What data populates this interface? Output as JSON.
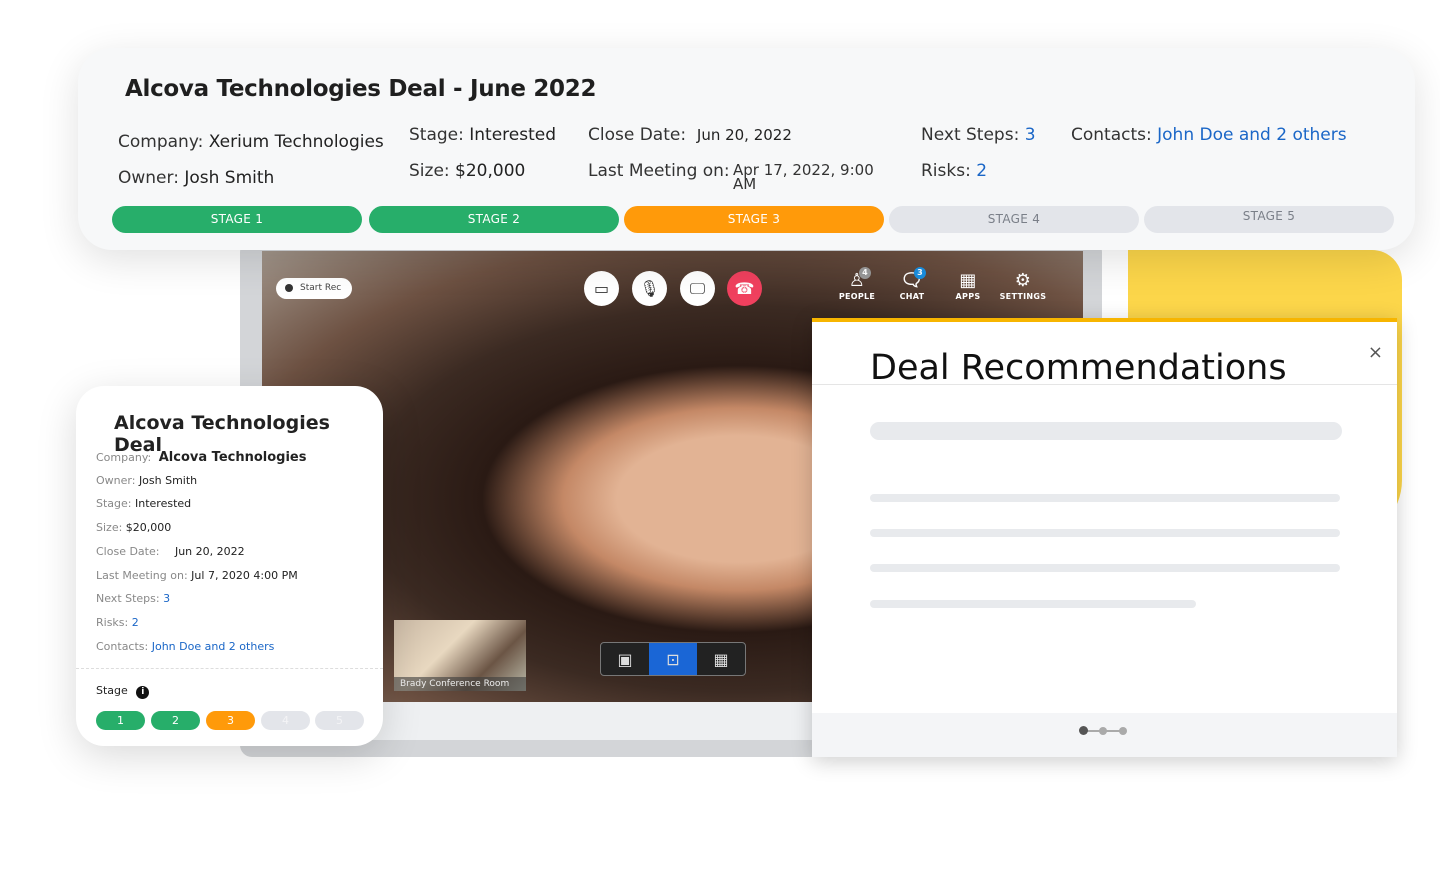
{
  "header": {
    "title": "Alcova Technologies Deal - June 2022",
    "company_label": "Company:",
    "company": "Xerium Technologies",
    "owner_label": "Owner:",
    "owner": "Josh Smith",
    "stage_label": "Stage:",
    "stage": "Interested",
    "size_label": "Size:",
    "size": "$20,000",
    "close_label": "Close Date:",
    "close": "Jun 20, 2022",
    "meeting_label": "Last Meeting on:",
    "meeting": "Apr 17, 2022, 9:00 AM",
    "next_label": "Next Steps:",
    "next": "3",
    "risks_label": "Risks:",
    "risks": "2",
    "contacts_label": "Contacts:",
    "contacts": "John Doe and 2 others",
    "stages": [
      {
        "label": "STAGE 1",
        "status": "done"
      },
      {
        "label": "STAGE 2",
        "status": "done"
      },
      {
        "label": "STAGE 3",
        "status": "current"
      },
      {
        "label": "STAGE 4",
        "status": "pending"
      },
      {
        "label": "STAGE 5",
        "status": "pending"
      }
    ]
  },
  "video": {
    "start_rec": "Start Rec",
    "nav": [
      {
        "label": "PEOPLE",
        "icon": "person-icon",
        "badge": "4"
      },
      {
        "label": "CHAT",
        "icon": "chat-icon",
        "badge": "3"
      },
      {
        "label": "APPS",
        "icon": "grid-icon"
      },
      {
        "label": "SETTINGS",
        "icon": "gear-icon"
      }
    ],
    "thumb_label": "Brady Conference Room"
  },
  "recommendations": {
    "title": "Deal Recommendations",
    "close": "×"
  },
  "card": {
    "title": "Alcova Technologies Deal",
    "rows": [
      {
        "k": "Company:",
        "v": "Alcova Technologies"
      },
      {
        "k": "Owner:",
        "v": "Josh Smith"
      },
      {
        "k": "Stage:",
        "v": "Interested"
      },
      {
        "k": "Size:",
        "v": "$20,000"
      },
      {
        "k": "Close Date:",
        "v": "Jun 20, 2022"
      },
      {
        "k": "Last Meeting on:",
        "v": "Jul 7, 2020 4:00 PM"
      },
      {
        "k": "Next Steps:",
        "v": "3"
      },
      {
        "k": "Risks:",
        "v": "2"
      },
      {
        "k": "Contacts:",
        "v": "John Doe and 2 others"
      }
    ],
    "stage_label": "Stage",
    "pills": [
      "1",
      "2",
      "3",
      "4",
      "5"
    ]
  },
  "colors": {
    "done": "#27ae6a",
    "current": "#ff9a0a",
    "pending": "#e3e5ea",
    "link": "#1a66c7",
    "accent": "#fcd64a"
  }
}
